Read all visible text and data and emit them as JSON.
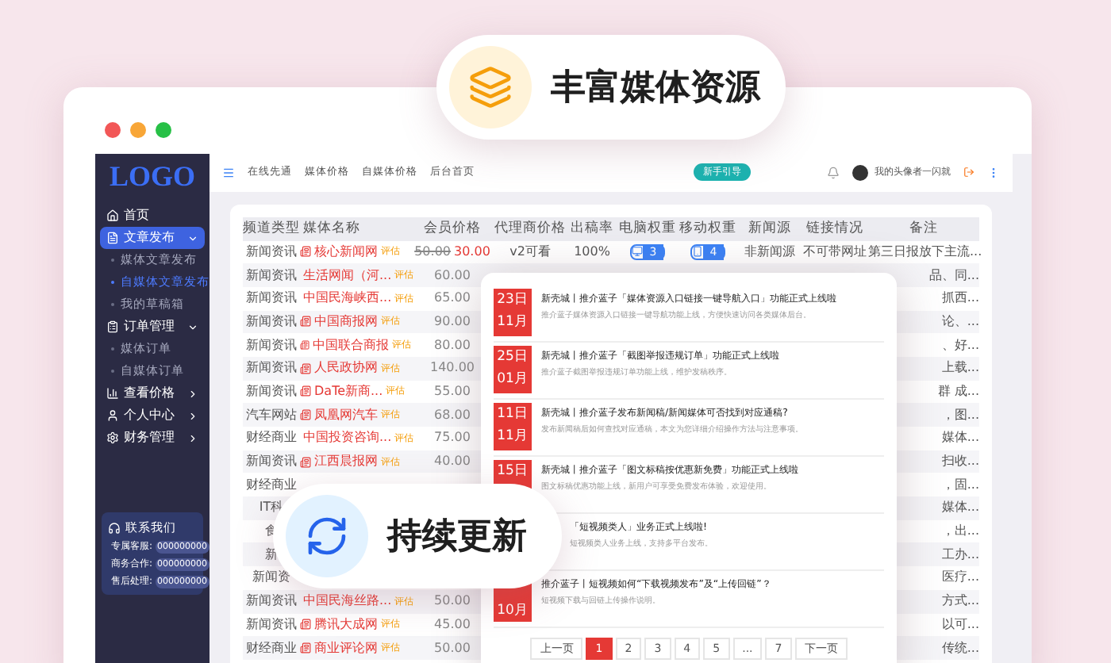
{
  "badges": [
    {
      "kind": "media",
      "text": "丰富媒体资源"
    },
    {
      "kind": "update",
      "text": "持续更新"
    }
  ],
  "sidebar": {
    "logo": "LOGO",
    "items": [
      {
        "label": "首页",
        "selected": false
      },
      {
        "label": "文章发布",
        "selected": true,
        "expanded": true,
        "children": [
          {
            "label": "媒体文章发布",
            "selected": false
          },
          {
            "label": "自媒体文章发布",
            "selected": true
          },
          {
            "label": "我的草稿箱",
            "selected": false
          }
        ]
      },
      {
        "label": "订单管理",
        "selected": false,
        "expanded": true,
        "children": [
          {
            "label": "媒体订单",
            "selected": false
          },
          {
            "label": "自媒体订单",
            "selected": false
          }
        ]
      },
      {
        "label": "查看价格",
        "selected": false,
        "expanded": false
      },
      {
        "label": "个人中心",
        "selected": false,
        "expanded": false
      },
      {
        "label": "财务管理",
        "selected": false,
        "expanded": false
      }
    ],
    "contact": {
      "title": "联系我们",
      "lines": [
        {
          "label": "专属客服:",
          "value": "000000000"
        },
        {
          "label": "商务合作:",
          "value": "000000000"
        },
        {
          "label": "售后处理:",
          "value": "000000000"
        }
      ]
    }
  },
  "top_nav": {
    "links": [
      "在线先通",
      "媒体价格",
      "自媒体价格",
      "后台首页"
    ],
    "guide_button": "新手引导",
    "user_name": "我的头像者一闪就"
  },
  "table": {
    "columns": [
      "频道类型",
      "媒体名称",
      "会员价格",
      "代理商价格",
      "出稿率",
      "电脑权重",
      "移动权重",
      "新闻源",
      "链接情况",
      "备注"
    ],
    "rows": [
      {
        "type": "新闻资讯",
        "name": "核心新闻网",
        "tag": "评估",
        "price": "50.00",
        "sale_price": "30.00",
        "agent_price": "v2可看",
        "rate": "100%",
        "pc_weight": "3",
        "mobile_weight": "4",
        "news_source": "非新闻源",
        "link": "不可带网址",
        "note": "第三日报放下主流..."
      },
      {
        "type": "新闻资讯",
        "name": "生活网闻（河...",
        "tag": "评估",
        "price": "60.00",
        "note": "品、同..."
      },
      {
        "type": "新闻资讯",
        "name": "中国民海峡西...",
        "tag": "评估",
        "price": "65.00",
        "note": "抓西..."
      },
      {
        "type": "新闻资讯",
        "name": "中国商报网",
        "tag": "评估",
        "price": "90.00",
        "note": "论、..."
      },
      {
        "type": "新闻资讯",
        "name": "中国联合商报",
        "tag": "评估",
        "price": "80.00",
        "note": "、好..."
      },
      {
        "type": "新闻资讯",
        "name": "人民政协网",
        "tag": "评估",
        "price": "140.00",
        "note": "上载..."
      },
      {
        "type": "新闻资讯",
        "name": "DaTe新商...",
        "tag": "评估",
        "price": "55.00",
        "note": "群 成..."
      },
      {
        "type": "汽车网站",
        "name": "凤凰网汽车",
        "tag": "评估",
        "price": "68.00",
        "note": "，图..."
      },
      {
        "type": "财经商业",
        "name": "中国投资咨询...",
        "tag": "评估",
        "price": "75.00",
        "note": "媒体..."
      },
      {
        "type": "新闻资讯",
        "name": "江西晨报网",
        "tag": "评估",
        "price": "40.00",
        "note": "扫收..."
      },
      {
        "type": "财经商业",
        "note": "，固..."
      },
      {
        "type": "IT科",
        "note": "媒体..."
      },
      {
        "type": "食",
        "note": "，出..."
      },
      {
        "type": "新",
        "note": "工办..."
      },
      {
        "type": "新闻资",
        "note": "医疗..."
      },
      {
        "type": "新闻资讯",
        "name": "中国民海丝路...",
        "tag": "评估",
        "price": "50.00",
        "note": "方式..."
      },
      {
        "type": "新闻资讯",
        "name": "腾讯大成网",
        "tag": "评估",
        "price": "45.00",
        "note": "以可..."
      },
      {
        "type": "财经商业",
        "name": "商业评论网",
        "tag": "评估",
        "price": "50.00",
        "note": "传统..."
      }
    ]
  },
  "news": {
    "items": [
      {
        "day": "23日",
        "month": "11月",
        "title": "新壳城丨推介蓝子「媒体资源入口链接一键导航入口」功能正式上线啦",
        "summary": "推介蓝子媒体资源入口链接一键导航功能上线，方便快速访问各类媒体后台。"
      },
      {
        "day": "25日",
        "month": "01月",
        "title": "新壳城丨推介蓝子「截图举报违规订单」功能正式上线啦",
        "summary": "推介蓝子截图举报违规订单功能上线，维护发稿秩序。"
      },
      {
        "day": "11日",
        "month": "11月",
        "title": "新壳城丨推介蓝子发布新闻稿/新闻媒体可否找到对应通稿?",
        "summary": "发布新闻稿后如何查找对应通稿，本文为您详细介绍操作方法与注意事项。"
      },
      {
        "day": "15日",
        "title": "新壳城丨推介蓝子「图文标稿按优惠新免费」功能正式上线啦",
        "summary": "图文标稿优惠功能上线，新用户可享受免费发布体验，欢迎使用。"
      },
      {
        "title": "「短视频类人」业务正式上线啦!",
        "summary": "短视频类人业务上线，支持多平台发布。"
      },
      {
        "month": "10月",
        "title": "推介蓝子丨短视频如何“下载视频发布”及“上传回链”？",
        "summary": "短视频下载与回链上传操作说明。"
      }
    ]
  },
  "pagination": [
    {
      "label": "上一页",
      "selected": false
    },
    {
      "label": "1",
      "selected": true
    },
    {
      "label": "2",
      "selected": false
    },
    {
      "label": "3",
      "selected": false
    },
    {
      "label": "4",
      "selected": false
    },
    {
      "label": "5",
      "selected": false
    },
    {
      "label": "...",
      "selected": false
    },
    {
      "label": "7",
      "selected": false
    },
    {
      "label": "下一页",
      "selected": false
    }
  ]
}
